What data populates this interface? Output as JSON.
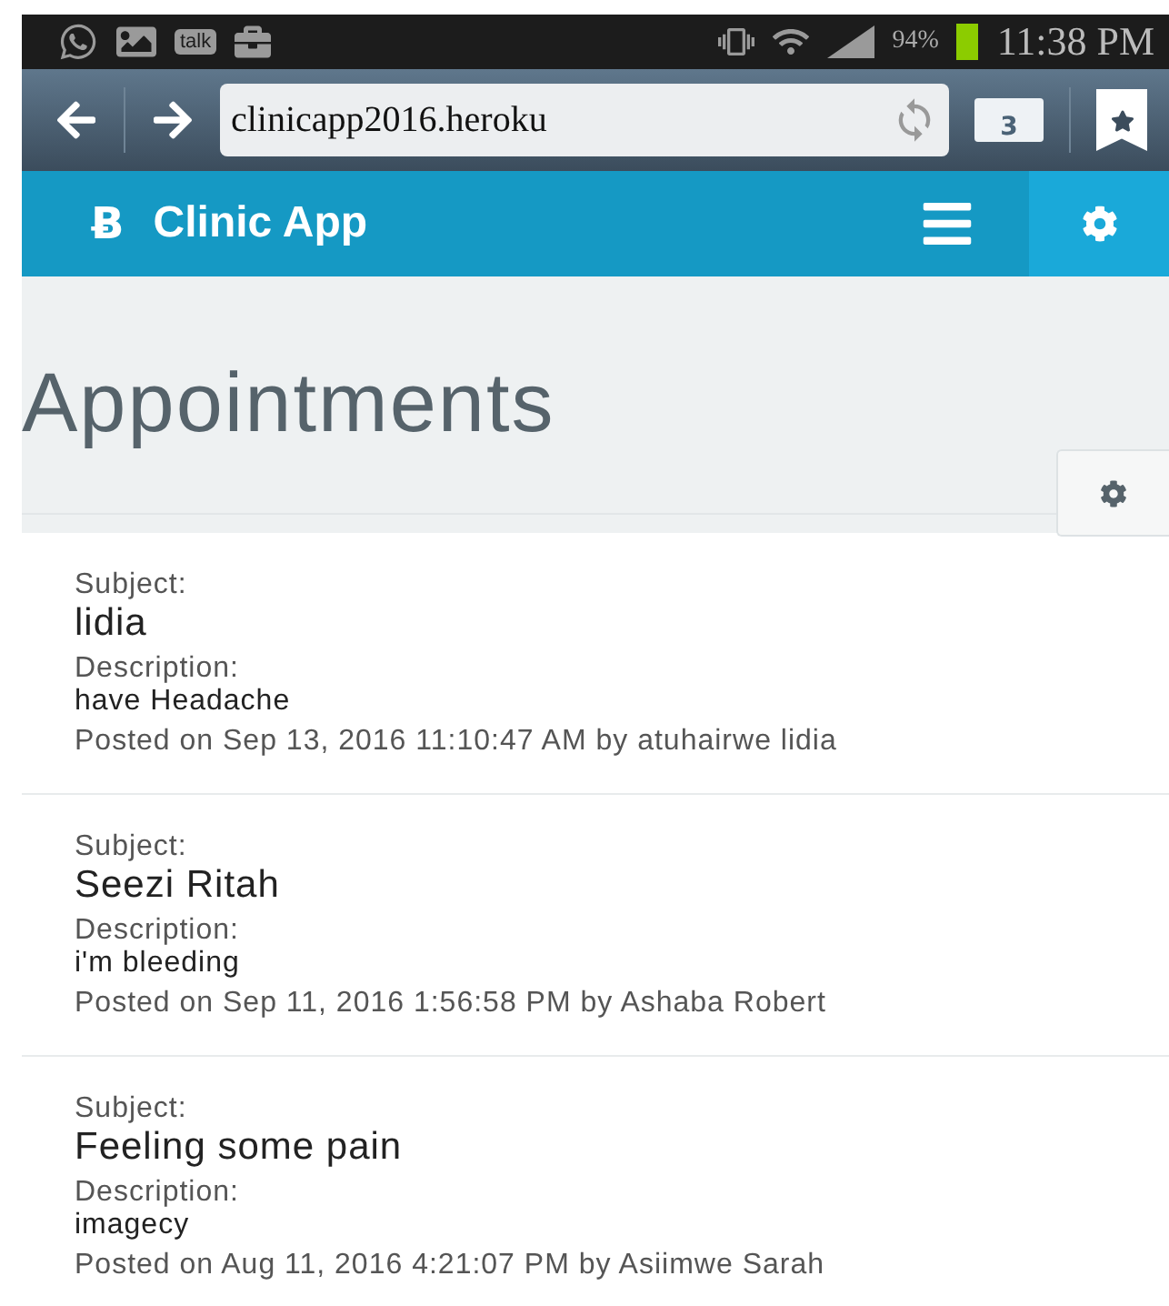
{
  "status_bar": {
    "battery": "94%",
    "time": "11:38 PM",
    "notification_badge": "talk"
  },
  "browser": {
    "url": "clinicapp2016.heroku",
    "tab_count": "3"
  },
  "app_bar": {
    "logo": "Ƀ",
    "title": "Clinic App"
  },
  "page": {
    "title": "Appointments"
  },
  "appointments": [
    {
      "subject_label": "Subject:",
      "subject": "lidia",
      "description_label": "Description:",
      "description": "have Headache",
      "posted": "Posted on Sep 13, 2016 11:10:47 AM by atuhairwe lidia"
    },
    {
      "subject_label": "Subject:",
      "subject": "Seezi Ritah",
      "description_label": "Description:",
      "description": "i'm bleeding",
      "posted": "Posted on Sep 11, 2016 1:56:58 PM by Ashaba Robert"
    },
    {
      "subject_label": "Subject:",
      "subject": "Feeling some pain",
      "description_label": "Description:",
      "description": "imagecy",
      "posted": "Posted on Aug 11, 2016 4:21:07 PM by Asiimwe Sarah"
    }
  ]
}
